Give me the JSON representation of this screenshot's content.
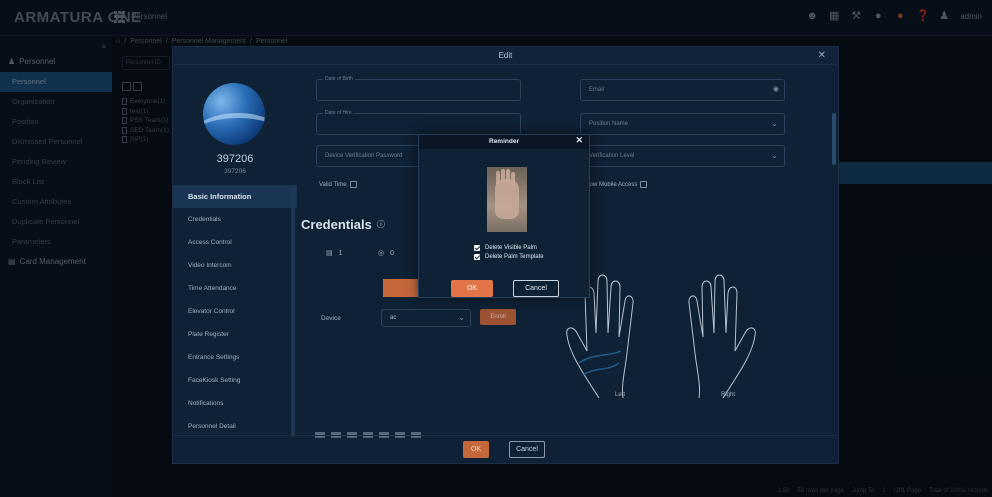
{
  "app": {
    "brand": "ARMATURA ONE",
    "module": "Personnel",
    "user": "admin"
  },
  "topbar_icons": [
    "people-icon",
    "grid-icon",
    "tools-icon",
    "bell-icon",
    "alert-icon",
    "help-icon",
    "user-icon"
  ],
  "sidebar": {
    "group": "Personnel",
    "items": [
      "Personnel",
      "Organization",
      "Position",
      "Dismissed Personnel",
      "Pending Review",
      "Block List",
      "Custom Attributes",
      "Duplicate Personnel",
      "Parameters"
    ],
    "card_group": "Card Management"
  },
  "breadcrumb": [
    "Personnel",
    "Personnel Management",
    "Personnel"
  ],
  "background": {
    "search_placeholder": "Personnel ID",
    "tree": [
      "Everyone(1)",
      "test(1)",
      "PSS Team(1)",
      "SED Team(1)",
      "SIP(1)"
    ],
    "pager": {
      "text": "1-50",
      "per_page": "50 rows per page",
      "jump": "Jump To",
      "page_input": "1",
      "pages": "/201 Page",
      "total": "Total of 10011 records"
    }
  },
  "edit_modal": {
    "title": "Edit",
    "person_id_big": "397206",
    "person_id_small": "397206",
    "tabs": [
      "Basic Information",
      "Credentials",
      "Access Control",
      "Video Intercom",
      "Time Attendance",
      "Elevator Control",
      "Plate Register",
      "Entrance Settings",
      "FaceKiosk Setting",
      "Notifications",
      "Personnel Detail"
    ],
    "fields": {
      "dob_label": "Date of Birth",
      "hire_label": "Date of Hire",
      "device_pw_placeholder": "Device Verification Password",
      "email_placeholder": "Email",
      "position_placeholder": "Position Name",
      "level_placeholder": "Verification Level",
      "valid_time": "Valid Time",
      "mobile_access": "Allow Mobile Access"
    },
    "credentials": {
      "title": "Credentials",
      "card_count": "1",
      "face_count": "0",
      "device_label": "Device",
      "device_value": "ac",
      "enroll": "Enroll",
      "left": "Left",
      "right": "Right"
    },
    "ok": "OK",
    "cancel": "Cancel"
  },
  "reminder": {
    "title": "Reminder",
    "opt1": "Delete Visible Palm",
    "opt2": "Delete Palm Template",
    "ok": "OK",
    "cancel": "Cancel"
  }
}
